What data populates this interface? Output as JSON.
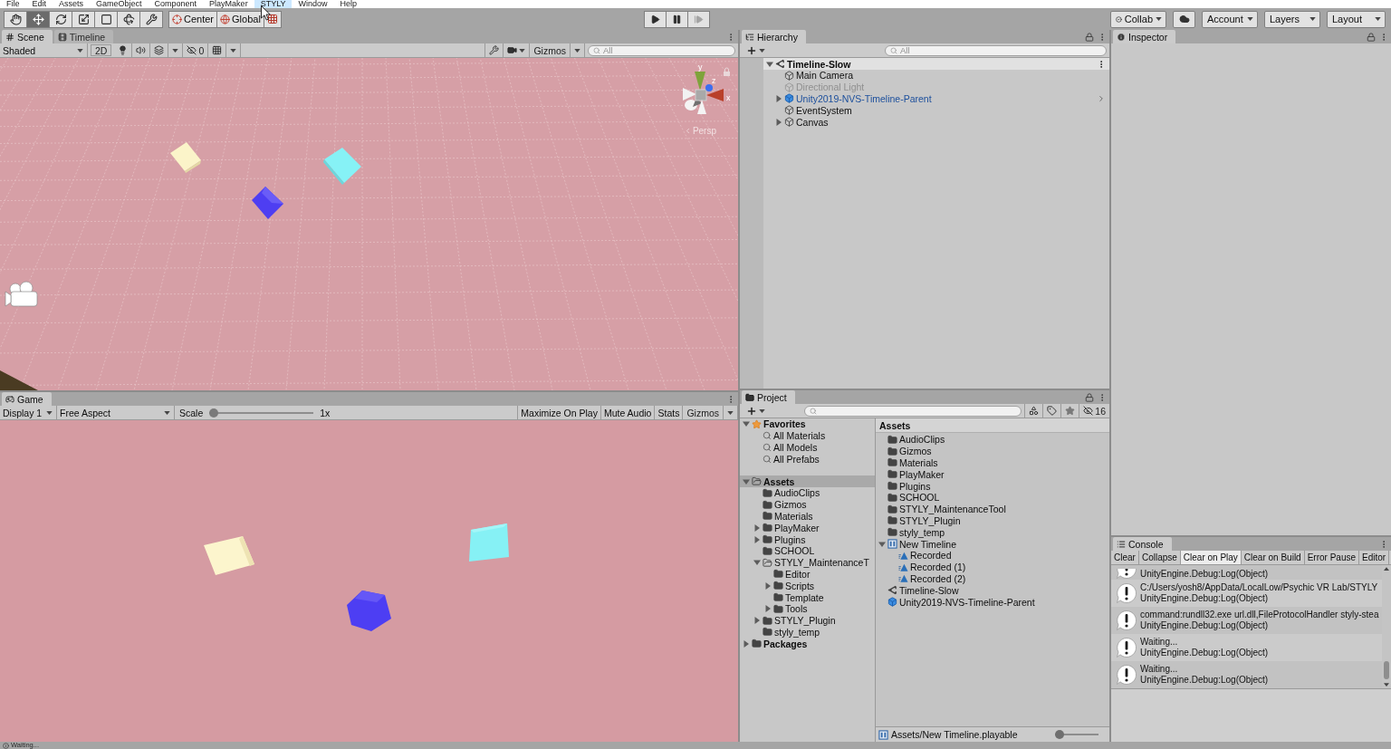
{
  "menu_bar": {
    "items": [
      {
        "label": "File",
        "selected": false
      },
      {
        "label": "Edit",
        "selected": false
      },
      {
        "label": "Assets",
        "selected": false
      },
      {
        "label": "GameObject",
        "selected": false
      },
      {
        "label": "Component",
        "selected": false
      },
      {
        "label": "PlayMaker",
        "selected": false
      },
      {
        "label": "STYLY",
        "selected": true
      },
      {
        "label": "Window",
        "selected": false
      },
      {
        "label": "Help",
        "selected": false
      }
    ]
  },
  "toolbar": {
    "tools": [
      {
        "kind": "hand",
        "selected": false
      },
      {
        "kind": "move",
        "selected": true
      },
      {
        "kind": "rotate",
        "selected": false
      },
      {
        "kind": "scale",
        "selected": false
      },
      {
        "kind": "rect",
        "selected": false
      },
      {
        "kind": "transform",
        "selected": false
      },
      {
        "kind": "custom",
        "selected": false
      }
    ],
    "pivot_mode": "Center",
    "pivot_rotation": "Global",
    "playback": [
      {
        "kind": "play",
        "disabled": false
      },
      {
        "kind": "pause",
        "disabled": false
      },
      {
        "kind": "step",
        "disabled": true
      }
    ],
    "collab": "Collab",
    "account": "Account",
    "layers": "Layers",
    "layout": "Layout"
  },
  "scene_panel": {
    "tabs": [
      {
        "kind": "scene",
        "label": "Scene",
        "selected": true
      },
      {
        "kind": "timeline",
        "label": "Timeline",
        "selected": false
      }
    ],
    "draw_mode": "Shaded",
    "mode_2d": {
      "label": "2D",
      "on": false
    },
    "hidden_count": "0",
    "gizmos": "Gizmos",
    "search": {
      "placeholder": "All"
    },
    "axis_labels": {
      "y": "y",
      "z": "z",
      "x": "x"
    },
    "projection": "Persp"
  },
  "game_panel": {
    "tab": "Game",
    "display": "Display 1",
    "aspect": "Free Aspect",
    "scale": {
      "label": "Scale",
      "level": 0,
      "reading": "1x"
    },
    "toggles": [
      {
        "label": "Maximize On Play",
        "on": false
      },
      {
        "label": "Mute Audio",
        "on": false
      },
      {
        "label": "Stats",
        "on": false
      }
    ],
    "gizmos": "Gizmos"
  },
  "hierarchy": {
    "tab": "Hierarchy",
    "search": {
      "placeholder": "All"
    },
    "scenes": [
      {
        "label": "Timeline-Slow",
        "expanded": true,
        "children": [
          {
            "kind": "object",
            "label": "Main Camera",
            "disabled": false,
            "selected": false
          },
          {
            "kind": "object",
            "label": "Directional Light",
            "disabled": true,
            "selected": false
          },
          {
            "kind": "prefab",
            "label": "Unity2019-NVS-Timeline-Parent",
            "expanded": false,
            "disabled": false,
            "selected": false
          },
          {
            "kind": "object",
            "label": "EventSystem",
            "disabled": false,
            "selected": false
          },
          {
            "kind": "object",
            "label": "Canvas",
            "expanded": false,
            "disabled": false,
            "selected": false
          }
        ]
      }
    ]
  },
  "inspector": {
    "tab": "Inspector"
  },
  "project": {
    "tab": "Project",
    "hidden_count": "16",
    "tree": [
      {
        "kind": "favorites",
        "label": "Favorites",
        "expanded": true,
        "selected": false,
        "children": [
          {
            "kind": "search",
            "label": "All Materials",
            "selected": false
          },
          {
            "kind": "search",
            "label": "All Models",
            "selected": false
          },
          {
            "kind": "search",
            "label": "All Prefabs",
            "selected": false
          }
        ]
      },
      {
        "kind": "folder",
        "label": "Assets",
        "expanded": true,
        "selected": true,
        "children": [
          {
            "kind": "folder",
            "label": "AudioClips",
            "selected": false
          },
          {
            "kind": "folder",
            "label": "Gizmos",
            "selected": false
          },
          {
            "kind": "folder",
            "label": "Materials",
            "selected": false
          },
          {
            "kind": "folder",
            "label": "PlayMaker",
            "expanded": false,
            "selected": false
          },
          {
            "kind": "folder",
            "label": "Plugins",
            "expanded": false,
            "selected": false
          },
          {
            "kind": "folder",
            "label": "SCHOOL",
            "selected": false
          },
          {
            "kind": "folder",
            "label": "STYLY_MaintenanceT",
            "expanded": true,
            "selected": false,
            "children": [
              {
                "kind": "folder",
                "label": "Editor",
                "selected": false
              },
              {
                "kind": "folder",
                "label": "Scripts",
                "expanded": false,
                "selected": false
              },
              {
                "kind": "folder",
                "label": "Template",
                "selected": false
              },
              {
                "kind": "folder",
                "label": "Tools",
                "expanded": false,
                "selected": false
              }
            ]
          },
          {
            "kind": "folder",
            "label": "STYLY_Plugin",
            "expanded": false,
            "selected": false
          },
          {
            "kind": "folder",
            "label": "styly_temp",
            "selected": false
          }
        ]
      },
      {
        "kind": "folder",
        "label": "Packages",
        "expanded": false,
        "selected": false
      }
    ],
    "list_header": "Assets",
    "items": [
      {
        "kind": "folder",
        "label": "AudioClips",
        "selected": false
      },
      {
        "kind": "folder",
        "label": "Gizmos",
        "selected": false
      },
      {
        "kind": "folder",
        "label": "Materials",
        "selected": false
      },
      {
        "kind": "folder",
        "label": "PlayMaker",
        "selected": false
      },
      {
        "kind": "folder",
        "label": "Plugins",
        "selected": false
      },
      {
        "kind": "folder",
        "label": "SCHOOL",
        "selected": false
      },
      {
        "kind": "folder",
        "label": "STYLY_MaintenanceTool",
        "selected": false
      },
      {
        "kind": "folder",
        "label": "STYLY_Plugin",
        "selected": false
      },
      {
        "kind": "folder",
        "label": "styly_temp",
        "selected": false
      },
      {
        "kind": "timeline",
        "label": "New Timeline",
        "expanded": true,
        "selected": false,
        "children": [
          {
            "kind": "clip",
            "label": "Recorded",
            "selected": false
          },
          {
            "kind": "clip",
            "label": "Recorded (1)",
            "selected": false
          },
          {
            "kind": "clip",
            "label": "Recorded (2)",
            "selected": false
          }
        ]
      },
      {
        "kind": "scene",
        "label": "Timeline-Slow",
        "selected": false
      },
      {
        "kind": "prefab",
        "label": "Unity2019-NVS-Timeline-Parent",
        "selected": false
      }
    ],
    "footer": {
      "path": "Assets/New Timeline.playable",
      "size_slider": {
        "level": 0
      }
    }
  },
  "console": {
    "tab": "Console",
    "buttons": [
      {
        "kind": "button",
        "label": "Clear"
      },
      {
        "kind": "toggle",
        "label": "Collapse",
        "on": false
      },
      {
        "kind": "toggle",
        "label": "Clear on Play",
        "on": true
      },
      {
        "kind": "toggle",
        "label": "Clear on Build",
        "on": false
      },
      {
        "kind": "toggle",
        "label": "Error Pause",
        "on": false
      },
      {
        "kind": "button",
        "label": "Editor"
      }
    ],
    "entries": [
      {
        "trace": "UnityEngine.Debug:Log(Object)",
        "selected": false
      },
      {
        "message": "C:/Users/yosh8/AppData/LocalLow/Psychic VR Lab/STYLY",
        "trace": "UnityEngine.Debug:Log(Object)",
        "selected": false
      },
      {
        "message": "command:rundll32.exe url.dll,FileProtocolHandler styly-stea",
        "trace": "UnityEngine.Debug:Log(Object)",
        "selected": false
      },
      {
        "message": "Waiting...",
        "trace": "UnityEngine.Debug:Log(Object)",
        "selected": false
      },
      {
        "message": "Waiting...",
        "trace": "UnityEngine.Debug:Log(Object)",
        "selected": false
      }
    ]
  },
  "status_bar": {
    "message": "Waiting..."
  }
}
